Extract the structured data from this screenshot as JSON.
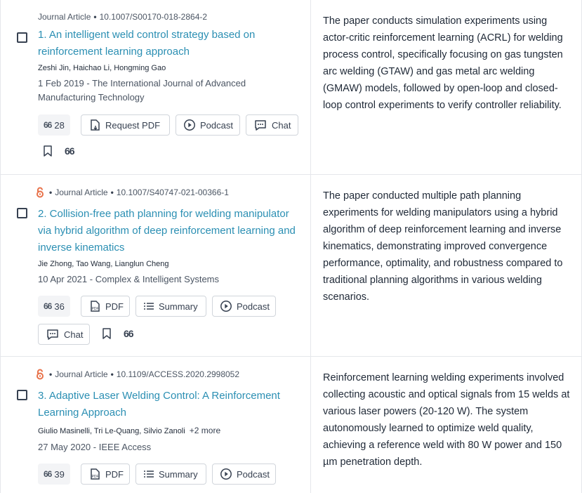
{
  "results": [
    {
      "open_access": false,
      "meta_type": "Journal Article",
      "doi": "10.1007/S00170-018-2864-2",
      "title": "1. An intelligent weld control strategy based on reinforcement learning approach",
      "authors": "Zeshi Jin, Haichao Li, Hongming Gao",
      "more_authors": "",
      "date": "1 Feb 2019",
      "journal": "The International Journal of Advanced Manufacturing Technology",
      "citations": "28",
      "buttons": {
        "pdf": "Request PDF",
        "podcast": "Podcast",
        "chat": "Chat"
      },
      "save_count": "66",
      "summary": "The paper conducts simulation experiments using actor-critic reinforcement learning (ACRL) for welding process control, specifically focusing on gas tungsten arc welding (GTAW) and gas metal arc welding (GMAW) models, followed by open-loop and closed-loop control experiments to verify controller reliability."
    },
    {
      "open_access": true,
      "meta_type": "Journal Article",
      "doi": "10.1007/S40747-021-00366-1",
      "title": "2. Collision-free path planning for welding manipulator via hybrid algorithm of deep reinforcement learning and inverse kinematics",
      "authors": "Jie Zhong, Tao Wang, Lianglun Cheng",
      "more_authors": "",
      "date": "10 Apr 2021",
      "journal": "Complex & Intelligent Systems",
      "citations": "36",
      "buttons": {
        "pdf": "PDF",
        "summary": "Summary",
        "podcast": "Podcast",
        "chat": "Chat"
      },
      "save_count": "66",
      "summary": "The paper conducted multiple path planning experiments for welding manipulators using a hybrid algorithm of deep reinforcement learning and inverse kinematics, demonstrating improved convergence performance, optimality, and robustness compared to traditional planning algorithms in various welding scenarios."
    },
    {
      "open_access": true,
      "meta_type": "Journal Article",
      "doi": "10.1109/ACCESS.2020.2998052",
      "title": "3. Adaptive Laser Welding Control: A Reinforcement Learning Approach",
      "authors": "Giulio Masinelli, Tri Le-Quang, Silvio Zanoli",
      "more_authors": "+2 more",
      "date": "27 May 2020",
      "journal": "IEEE Access",
      "citations": "39",
      "buttons": {
        "pdf": "PDF",
        "summary": "Summary",
        "podcast": "Podcast"
      },
      "summary": "Reinforcement learning welding experiments involved collecting acoustic and optical signals from 15 welds at various laser powers (20-120 W). The system autonomously learned to optimize weld quality, achieving a reference weld with 80 W power and 150 µm penetration depth."
    }
  ],
  "quote_glyph": "66",
  "colors": {
    "title": "#2b8fb3",
    "open_access": "#e8724a",
    "border": "#e5e7eb"
  }
}
